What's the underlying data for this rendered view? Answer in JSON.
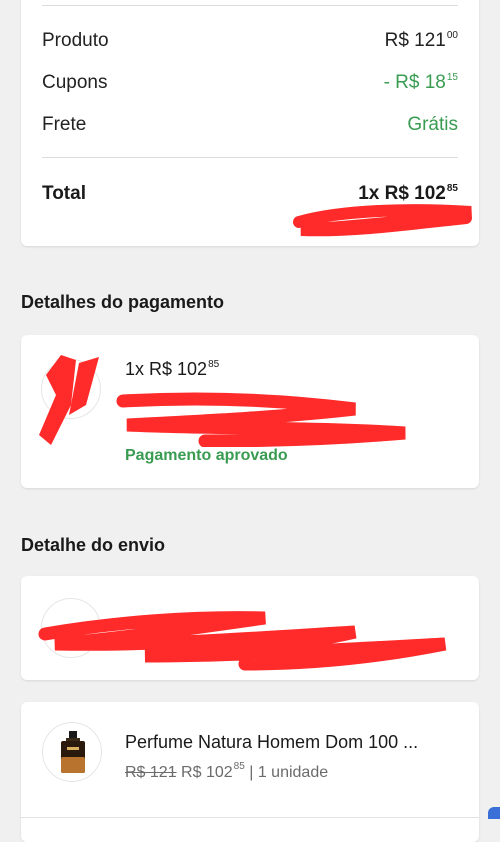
{
  "summary": {
    "rows": [
      {
        "label": "Produto",
        "value_main": "R$ 121",
        "value_cents": "00"
      },
      {
        "label": "Cupons",
        "value_main": "- R$ 18",
        "value_cents": "15"
      },
      {
        "label": "Frete",
        "value_main": "Grátis",
        "value_cents": ""
      }
    ],
    "total": {
      "label": "Total",
      "value_main": "1x R$ 102",
      "value_cents": "85"
    }
  },
  "payment": {
    "title": "Detalhes do pagamento",
    "amount_main": "1x R$ 102",
    "amount_cents": "85",
    "status": "Pagamento aprovado"
  },
  "shipping": {
    "title": "Detalhe do envio"
  },
  "item": {
    "name": "Perfume Natura Homem Dom 100 ...",
    "old_price": "R$ 121",
    "price_main": "R$ 102",
    "price_cents": "85",
    "quantity": "1 unidade"
  },
  "colors": {
    "green": "#3a9c52",
    "redaction": "#ff2a2a"
  }
}
